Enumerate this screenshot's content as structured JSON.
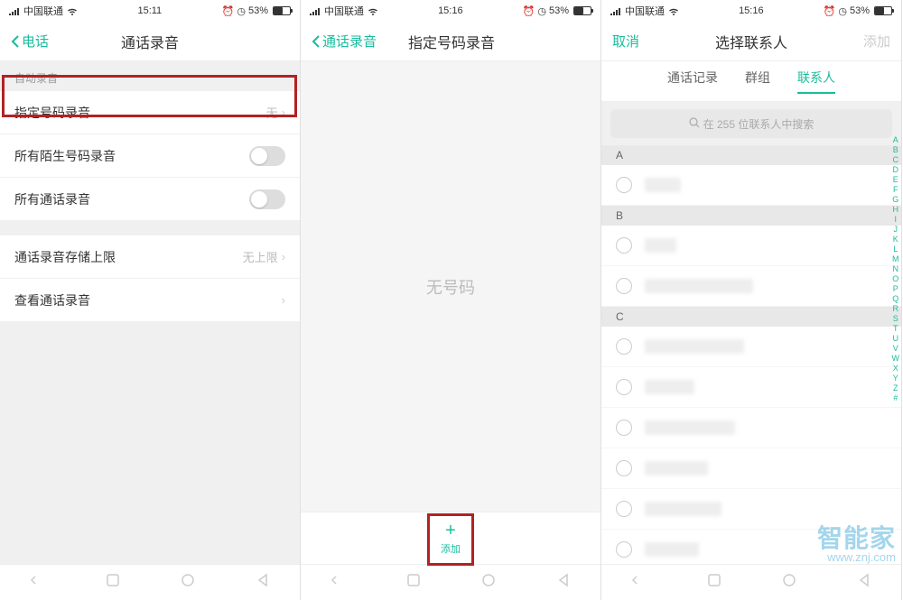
{
  "status": {
    "carrier": "中国联通",
    "battery_text": "53%",
    "s1_time": "15:11",
    "s2_time": "15:16",
    "s3_time": "15:16"
  },
  "screen1": {
    "back_label": "电话",
    "title": "通话录音",
    "section_auto": "自动录音",
    "row_specific": "指定号码录音",
    "row_specific_value": "无",
    "row_stranger": "所有陌生号码录音",
    "row_allcalls": "所有通话录音",
    "row_storage": "通话录音存储上限",
    "row_storage_value": "无上限",
    "row_view": "查看通话录音"
  },
  "screen2": {
    "back_label": "通话录音",
    "title": "指定号码录音",
    "empty_text": "无号码",
    "add_label": "添加"
  },
  "screen3": {
    "cancel": "取消",
    "title": "选择联系人",
    "add": "添加",
    "tab_calllog": "通话记录",
    "tab_group": "群组",
    "tab_contacts": "联系人",
    "search_placeholder": "在 255 位联系人中搜索",
    "sections": {
      "a": "A",
      "b": "B",
      "c": "C"
    },
    "index_letters": [
      "A",
      "B",
      "C",
      "D",
      "E",
      "F",
      "G",
      "H",
      "I",
      "J",
      "K",
      "L",
      "M",
      "N",
      "O",
      "P",
      "Q",
      "R",
      "S",
      "T",
      "U",
      "V",
      "W",
      "X",
      "Y",
      "Z",
      "#"
    ]
  },
  "watermark": {
    "brand": "智能家",
    "url": "www.znj.com"
  }
}
